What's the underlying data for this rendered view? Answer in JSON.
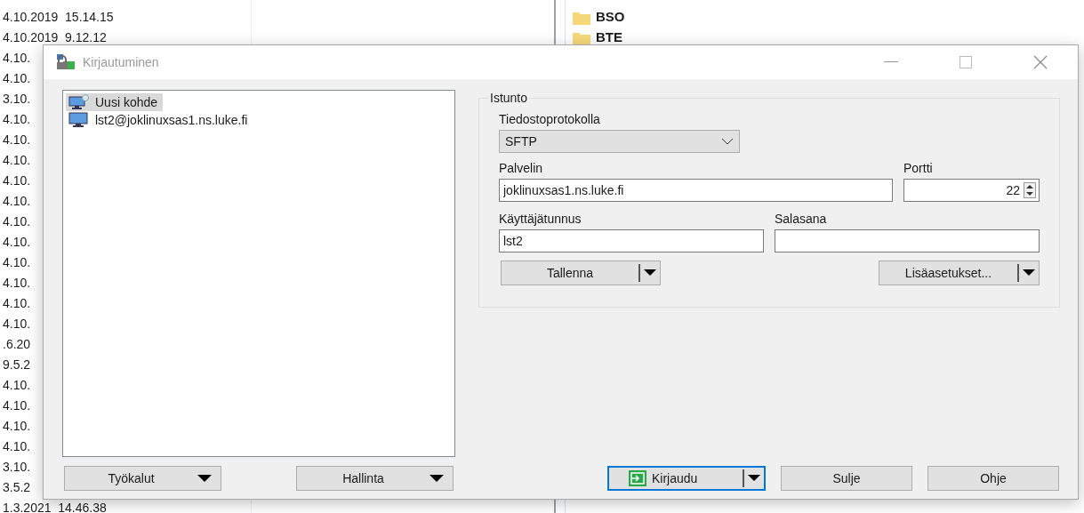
{
  "background": {
    "dates": [
      "4.10.2019  15.14.15",
      "4.10.2019  9.12.12",
      "4.10.",
      "4.10.",
      "3.10.",
      "4.10.",
      "4.10.",
      "4.10.",
      "4.10.",
      "4.10.",
      "4.10.",
      "4.10.",
      "4.10.",
      "4.10.",
      "4.10.",
      "4.10.",
      ".6.20",
      "9.5.2",
      "4.10.",
      "4.10.",
      "4.10.",
      "4.10.",
      "3.10.",
      "3.5.2",
      "1.3.2021  14.46.38"
    ],
    "folders": [
      "BSO",
      "BTE"
    ]
  },
  "window": {
    "title": "Kirjautuminen",
    "active": false
  },
  "sites": [
    {
      "label": "Uusi kohde",
      "kind": "new",
      "selected": true
    },
    {
      "label": "lst2@joklinuxsas1.ns.luke.fi",
      "kind": "site",
      "selected": false
    }
  ],
  "left_buttons": [
    "Työkalut",
    "Hallinta"
  ],
  "session": {
    "title": "Istunto",
    "protocol_label": "Tiedostoprotokolla",
    "protocol": "SFTP",
    "host_label": "Palvelin",
    "host": "joklinuxsas1.ns.luke.fi",
    "port_label": "Portti",
    "port": "22",
    "user_label": "Käyttäjätunnus",
    "user": "lst2",
    "password_label": "Salasana",
    "save_button": "Tallenna",
    "advanced_button": "Lisäasetukset..."
  },
  "bottom_buttons": [
    {
      "label": "Kirjaudu",
      "kind": "login"
    },
    {
      "label": "Sulje",
      "kind": "plain"
    },
    {
      "label": "Ohje",
      "kind": "plain"
    }
  ]
}
